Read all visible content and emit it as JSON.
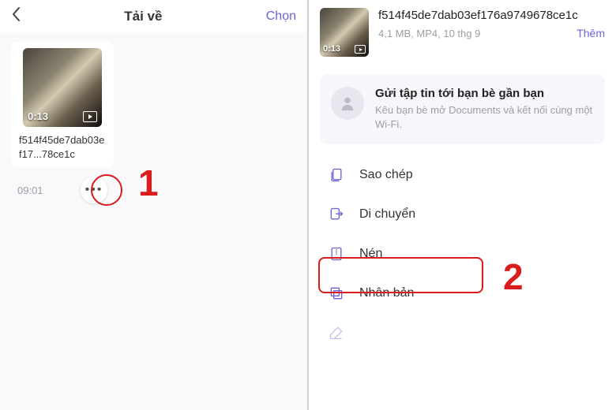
{
  "left": {
    "header": {
      "title": "Tải về",
      "action": "Chọn"
    },
    "file": {
      "name": "f514f45de7dab03ef17...78ce1c",
      "duration": "0:13",
      "time": "09:01"
    },
    "callout": "1"
  },
  "right": {
    "file": {
      "name": "f514f45de7dab03ef176a9749678ce1c",
      "duration": "0:13",
      "meta": "4,1 MB, MP4, 10 thg 9",
      "more_label": "Thêm"
    },
    "share": {
      "title": "Gửi tập tin tới bạn bè gần bạn",
      "subtitle": "Kêu bạn bè mở Documents và kết nối cùng một Wi-Fi."
    },
    "actions": {
      "copy": "Sao chép",
      "move": "Di chuyển",
      "compress": "Nén",
      "duplicate": "Nhân bản",
      "rename": ""
    },
    "callout": "2"
  }
}
